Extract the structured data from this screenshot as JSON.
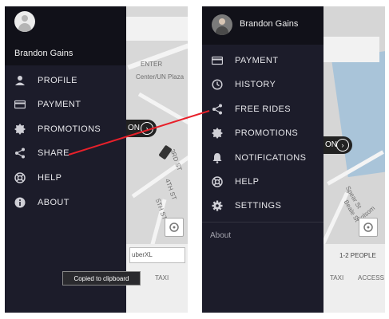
{
  "left_screen": {
    "user_name": "Brandon Gains",
    "menu": [
      {
        "label": "PROFILE",
        "icon": "person-icon"
      },
      {
        "label": "PAYMENT",
        "icon": "card-icon"
      },
      {
        "label": "PROMOTIONS",
        "icon": "badge-icon"
      },
      {
        "label": "SHARE",
        "icon": "share-icon"
      },
      {
        "label": "HELP",
        "icon": "lifebuoy-icon"
      },
      {
        "label": "ABOUT",
        "icon": "info-icon"
      }
    ],
    "toast": "Copied to clipboard",
    "map": {
      "pill_text": "ON",
      "vehicle_label": "uberXL",
      "bottom_label": "TAXI",
      "street_labels": [
        "ENTER",
        "Center/UN Plaza",
        "3RD ST",
        "4TH ST",
        "5TH ST"
      ]
    }
  },
  "right_screen": {
    "user_name": "Brandon Gains",
    "menu": [
      {
        "label": "PAYMENT",
        "icon": "card-icon"
      },
      {
        "label": "HISTORY",
        "icon": "clock-icon"
      },
      {
        "label": "FREE RIDES",
        "icon": "share-icon"
      },
      {
        "label": "PROMOTIONS",
        "icon": "badge-icon"
      },
      {
        "label": "NOTIFICATIONS",
        "icon": "bell-icon"
      },
      {
        "label": "HELP",
        "icon": "lifebuoy-icon"
      },
      {
        "label": "SETTINGS",
        "icon": "gear-icon"
      }
    ],
    "about_label": "About",
    "map": {
      "pill_text": "ON",
      "capacity_label": "1-2 PEOPLE",
      "bottom_labels": [
        "TAXI",
        "ACCESS"
      ],
      "street_labels": [
        "Spear St",
        "Beale St",
        "Folsom St"
      ]
    }
  },
  "colors": {
    "drawer": "#1c1c2a",
    "drawer_header": "#111119",
    "arrow": "#e8202a"
  }
}
